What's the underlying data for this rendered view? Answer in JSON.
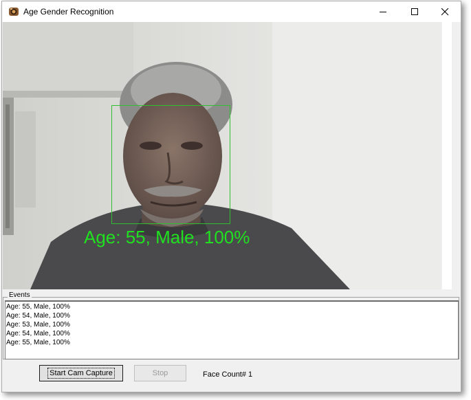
{
  "window": {
    "title": "Age Gender Recognition",
    "app_icon": "camera-app-icon",
    "controls": [
      "minimize-icon",
      "maximize-icon",
      "close-icon"
    ]
  },
  "video": {
    "overlay_label": "Age: 55, Male, 100%",
    "overlay_color": "#20e020",
    "face_box_color": "#2fbf2f"
  },
  "events": {
    "legend": "Events",
    "items": [
      "Age: 55, Male, 100%",
      "Age: 54, Male, 100%",
      "Age: 53, Male, 100%",
      "Age: 54, Male, 100%",
      "Age: 55, Male, 100%"
    ]
  },
  "controls": {
    "start_label": "Start Cam Capture",
    "stop_label": "Stop",
    "face_count": "Face Count# 1"
  }
}
